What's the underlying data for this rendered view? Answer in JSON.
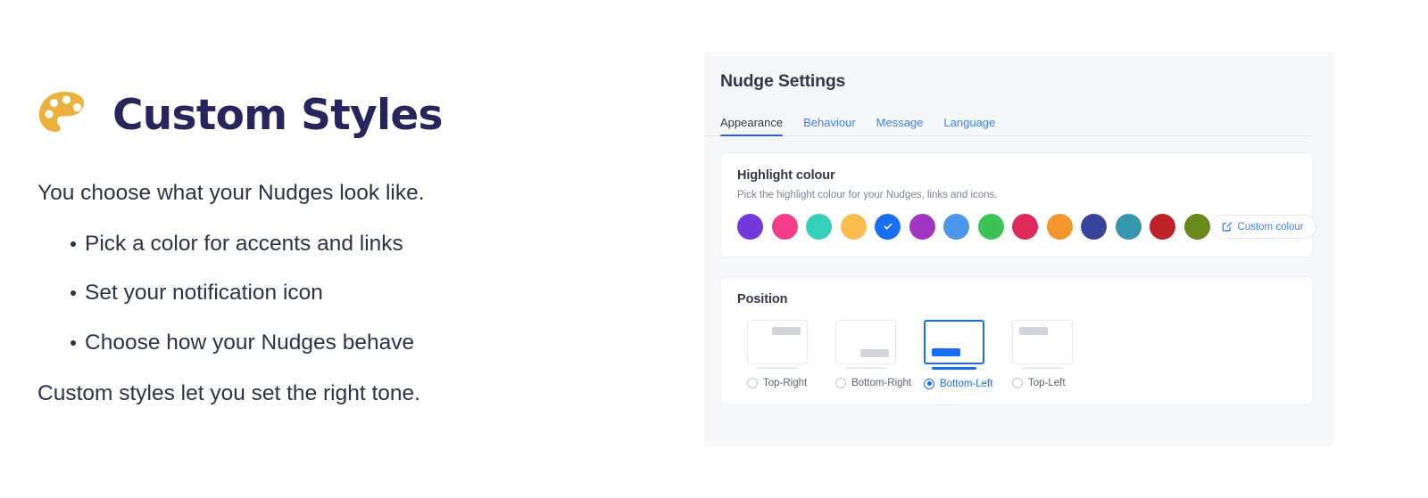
{
  "left": {
    "icon": "palette-icon",
    "icon_color": "#ecb13c",
    "title": "Custom Styles",
    "title_color": "#26265c",
    "lead": "You choose what your Nudges look like.",
    "bullets": [
      "Pick a color for accents and links",
      "Set your notification icon",
      "Choose how your Nudges behave"
    ],
    "outro": "Custom styles let you set the right tone."
  },
  "panel": {
    "title": "Nudge Settings",
    "accent": "#2563eb",
    "background": "#f6f7f9",
    "tabs": [
      {
        "label": "Appearance",
        "active": true
      },
      {
        "label": "Behaviour",
        "active": false
      },
      {
        "label": "Message",
        "active": false
      },
      {
        "label": "Language",
        "active": false
      }
    ],
    "highlight": {
      "title": "Highlight colour",
      "subtitle": "Pick the highlight colour for your Nudges, links and icons.",
      "selected_index": 4,
      "swatches": [
        {
          "name": "swatch-purple",
          "color": "#7339dd"
        },
        {
          "name": "swatch-pink",
          "color": "#f53d8c"
        },
        {
          "name": "swatch-turquoise",
          "color": "#35cfbb"
        },
        {
          "name": "swatch-amber",
          "color": "#fbbc4f"
        },
        {
          "name": "swatch-blue",
          "color": "#1a6ef5"
        },
        {
          "name": "swatch-violet",
          "color": "#a036bf"
        },
        {
          "name": "swatch-sky-blue",
          "color": "#4b96ea"
        },
        {
          "name": "swatch-green",
          "color": "#3cc255"
        },
        {
          "name": "swatch-crimson",
          "color": "#df2a5c"
        },
        {
          "name": "swatch-orange",
          "color": "#f0962a"
        },
        {
          "name": "swatch-indigo",
          "color": "#37449a"
        },
        {
          "name": "swatch-teal",
          "color": "#3596ac"
        },
        {
          "name": "swatch-dark-red",
          "color": "#bd2228"
        },
        {
          "name": "swatch-olive",
          "color": "#68891a"
        }
      ],
      "custom_button": {
        "label": "Custom colour",
        "icon": "edit-square-icon"
      }
    },
    "position": {
      "title": "Position",
      "selected_index": 2,
      "options": [
        {
          "label": "Top-Right",
          "corner": "pos-tr"
        },
        {
          "label": "Bottom-Right",
          "corner": "pos-br"
        },
        {
          "label": "Bottom-Left",
          "corner": "pos-bl"
        },
        {
          "label": "Top-Left",
          "corner": "pos-tl"
        }
      ]
    }
  }
}
